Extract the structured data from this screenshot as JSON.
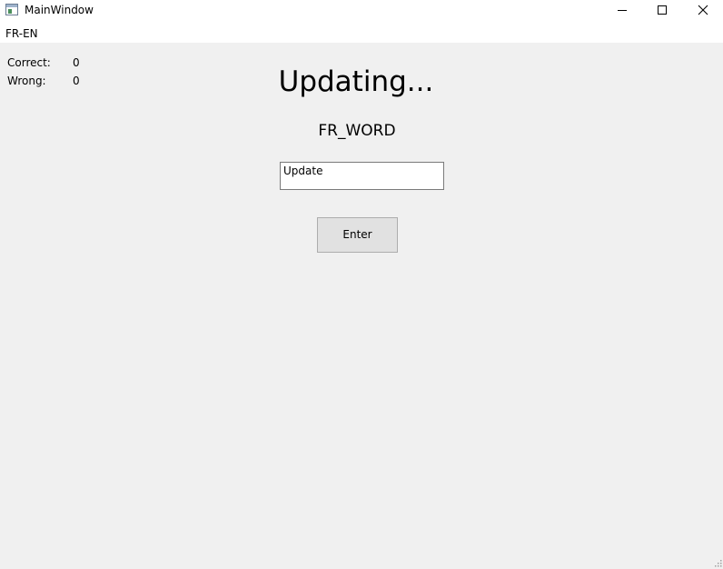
{
  "window": {
    "title": "MainWindow",
    "icon": "app-window-icon",
    "controls": {
      "minimize_icon": "minimize-icon",
      "maximize_icon": "maximize-icon",
      "close_icon": "close-icon"
    }
  },
  "menubar": {
    "items": [
      {
        "label": "FR-EN"
      }
    ]
  },
  "scoreboard": {
    "correct_label": "Correct:",
    "correct_value": "0",
    "wrong_label": "Wrong:",
    "wrong_value": "0"
  },
  "main": {
    "status_title": "Updating...",
    "word": "FR_WORD",
    "answer_input_value": "Update",
    "enter_button_label": "Enter"
  },
  "colors": {
    "window_background": "#f0f0f0",
    "titlebar_background": "#ffffff",
    "button_face": "#e1e1e1",
    "button_border": "#adadad",
    "input_border": "#7a7a7a"
  }
}
